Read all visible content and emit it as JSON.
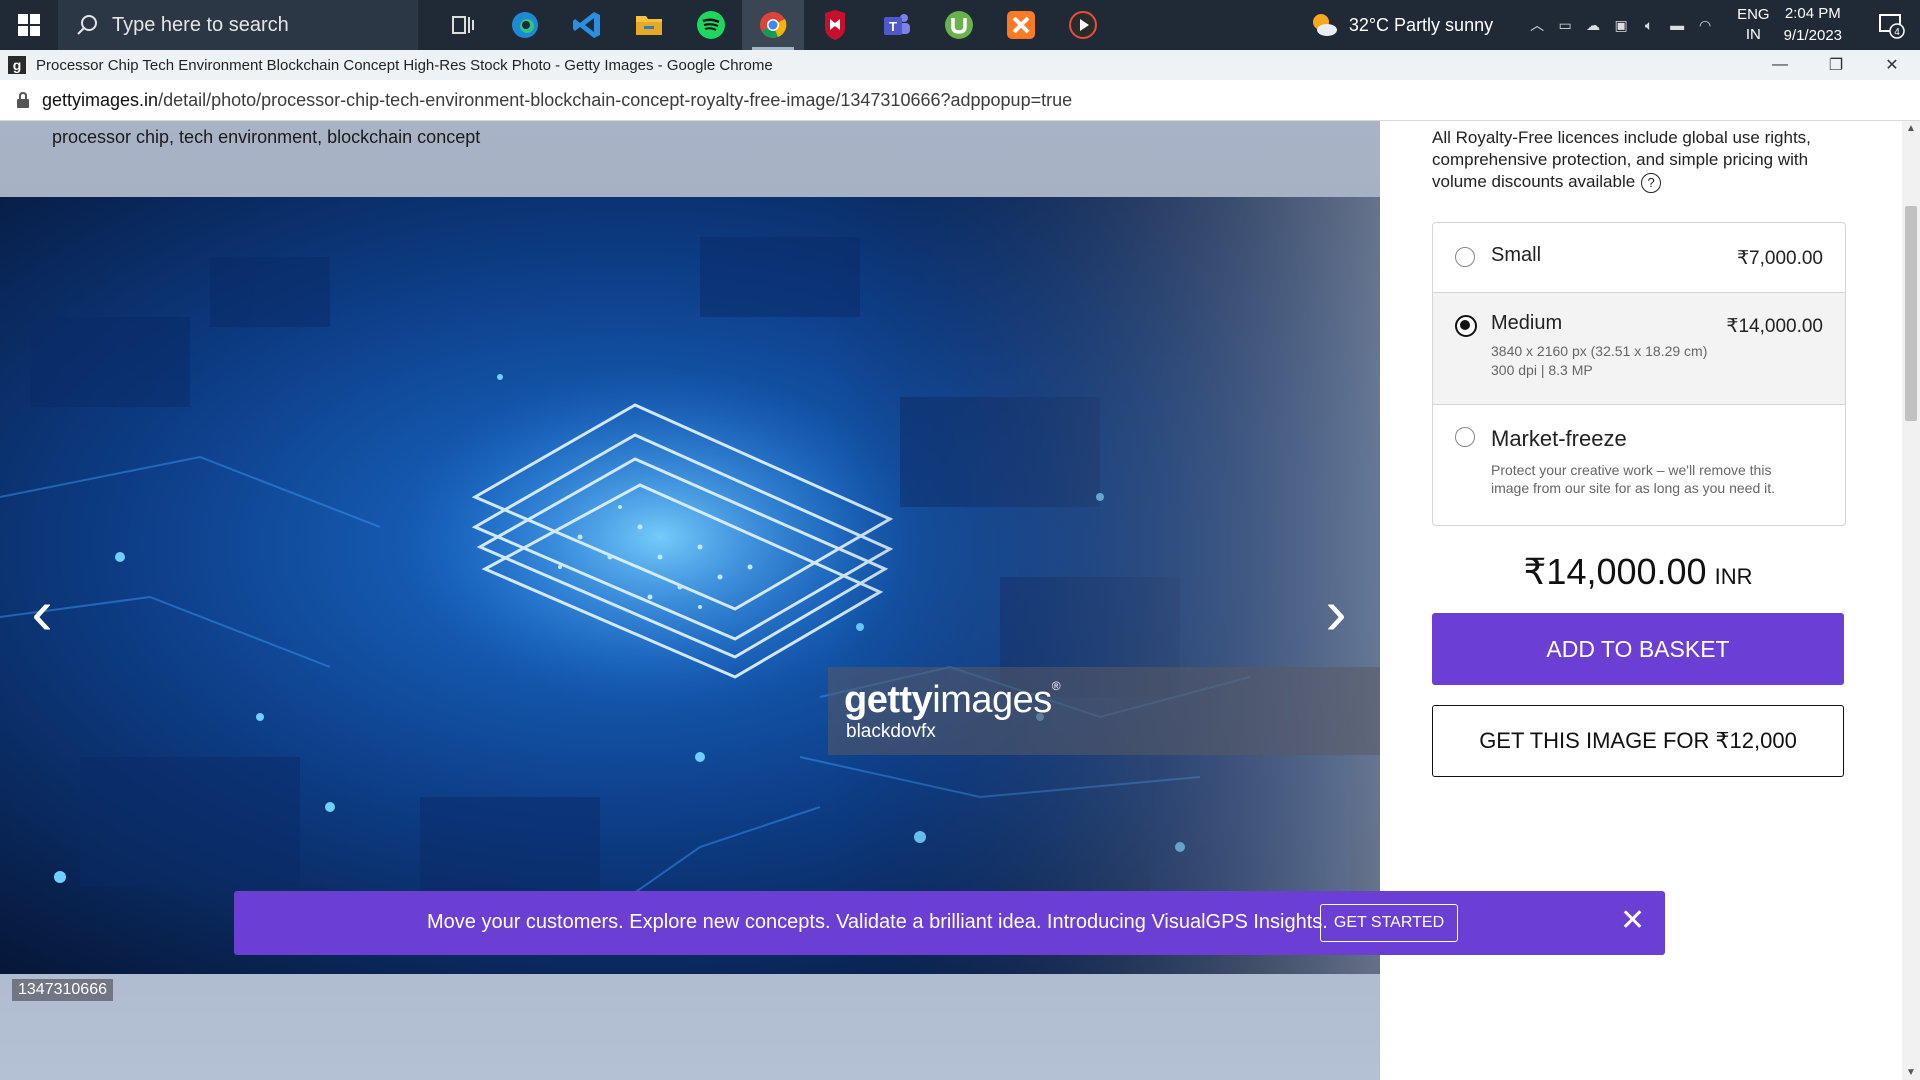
{
  "taskbar": {
    "search_placeholder": "Type here to search",
    "apps": [
      "task-view",
      "edge",
      "vscode",
      "file-explorer",
      "spotify",
      "chrome",
      "mcafee",
      "teams",
      "utorrent",
      "xampp",
      "media-player"
    ],
    "weather": "32°C  Partly sunny",
    "lang_top": "ENG",
    "lang_bottom": "IN",
    "time": "2:04 PM",
    "date": "9/1/2023",
    "notif_count": "4"
  },
  "browser": {
    "title": "Processor Chip Tech Environment Blockchain Concept High-Res Stock Photo - Getty Images - Google Chrome",
    "url_host": "gettyimages.in",
    "url_path": "/detail/photo/processor-chip-tech-environment-blockchain-concept-royalty-free-image/1347310666?adppopup=true"
  },
  "photo": {
    "caption": "processor chip, tech environment, blockchain concept",
    "watermark_brand_bold": "getty",
    "watermark_brand_light": "images",
    "watermark_reg": "®",
    "credit": "blackdovfx",
    "image_id": "1347310666"
  },
  "licence": {
    "text": "All Royalty-Free licences include global use rights, comprehensive protection, and simple pricing with volume discounts available",
    "options": [
      {
        "name": "Small",
        "price": "₹7,000.00",
        "selected": false
      },
      {
        "name": "Medium",
        "price": "₹14,000.00",
        "sub1": "3840 x 2160 px (32.51 x 18.29 cm)",
        "sub2": "300 dpi | 8.3 MP",
        "selected": true
      },
      {
        "name": "Market-freeze",
        "sub1": "Protect your creative work – we'll remove this image from our site for as long as you need it.",
        "selected": false
      }
    ],
    "total": "₹14,000.00",
    "currency": "INR",
    "add_to_basket": "ADD TO BASKET",
    "get_image": "GET THIS IMAGE FOR ₹12,000"
  },
  "banner": {
    "text": "Move your customers. Explore new concepts. Validate a brilliant idea. Introducing VisualGPS Insights.",
    "button": "GET STARTED"
  },
  "colors": {
    "accent": "#6b3fd4",
    "taskbar": "#1f2a36"
  }
}
